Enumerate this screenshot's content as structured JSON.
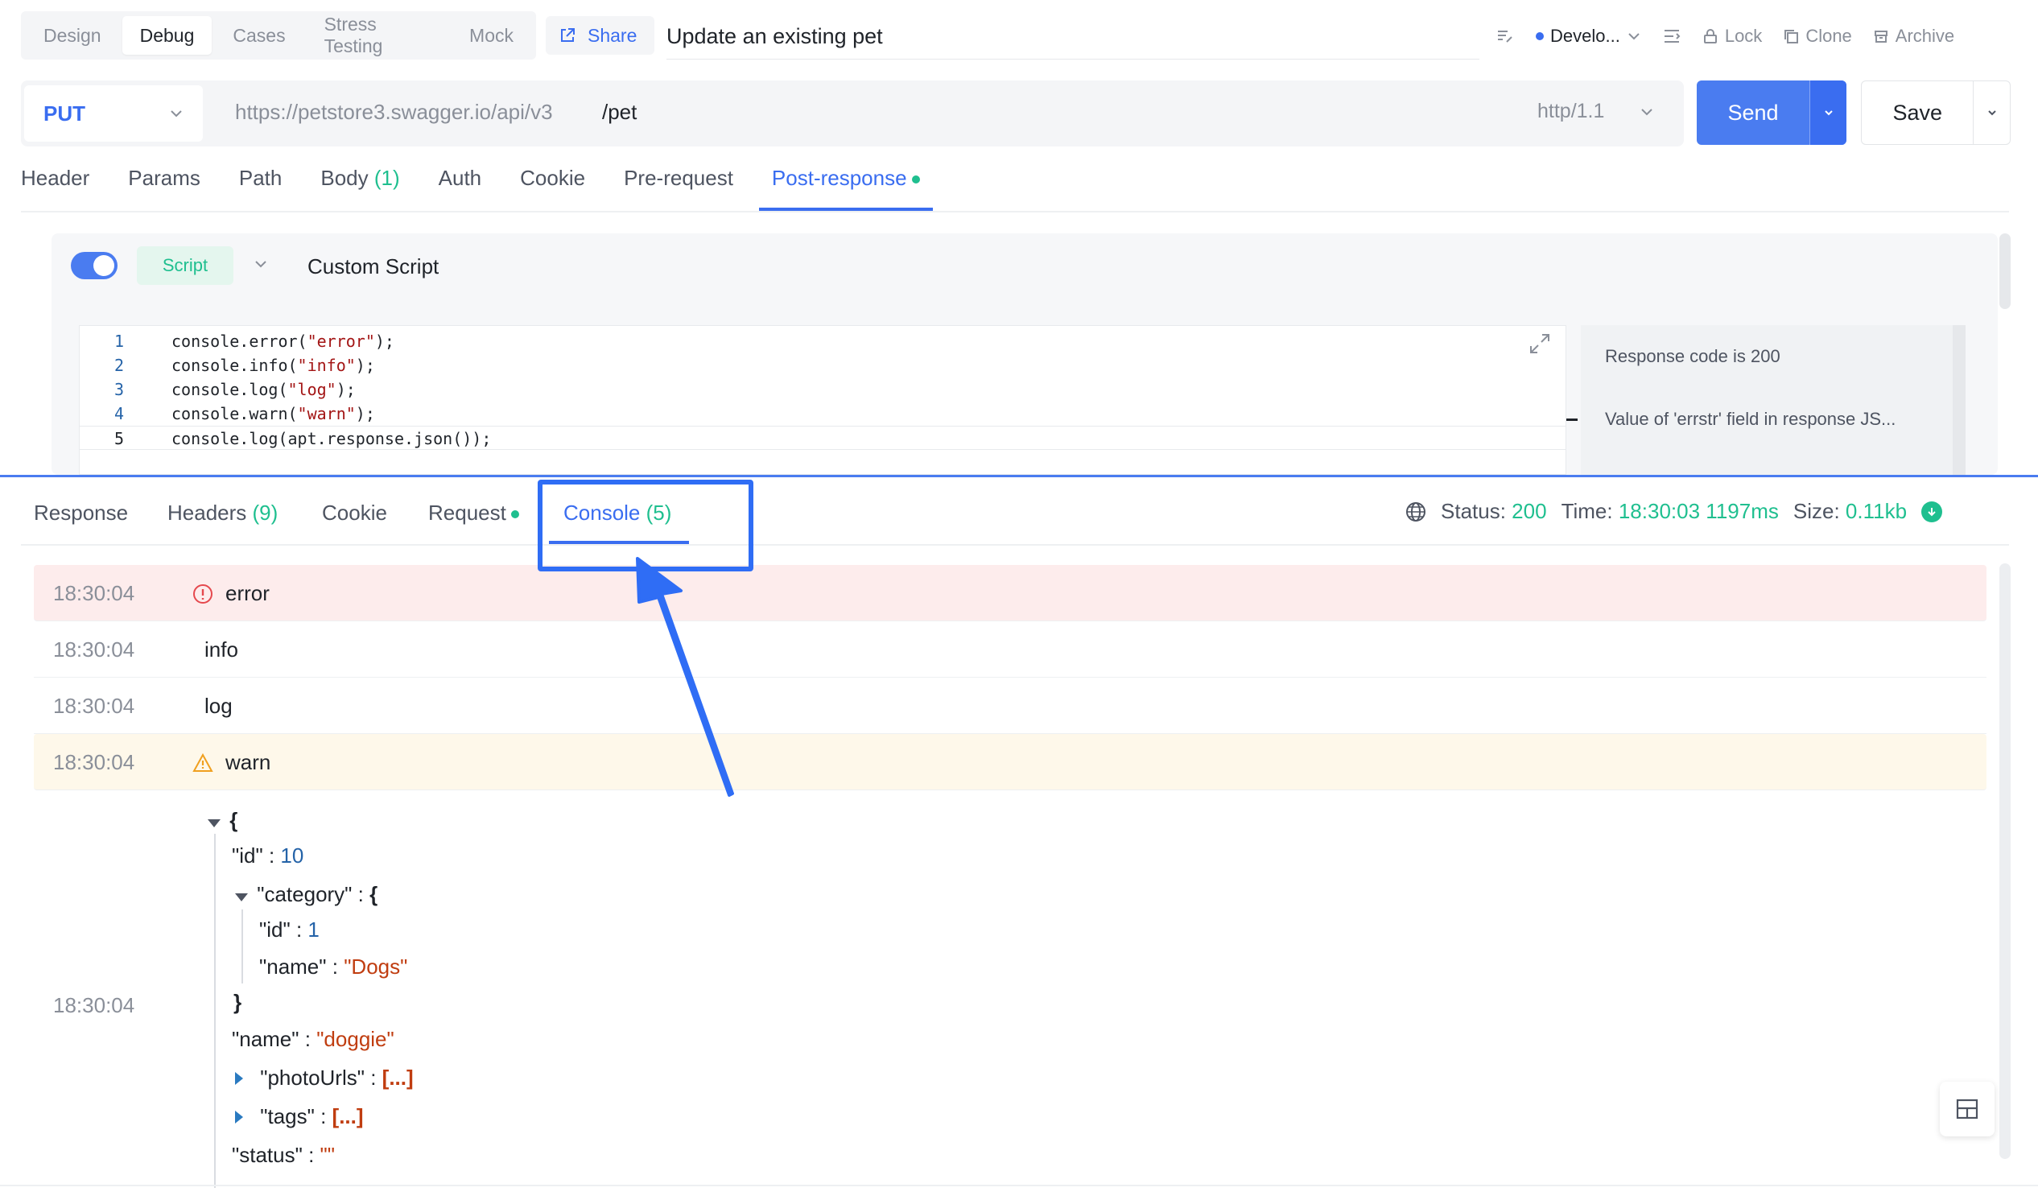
{
  "mode_tabs": [
    "Design",
    "Debug",
    "Cases",
    "Stress Testing",
    "Mock"
  ],
  "active_mode": "Debug",
  "share_label": "Share",
  "api_title": "Update an existing pet",
  "toolbar": {
    "environment": "Develo...",
    "lock": "Lock",
    "clone": "Clone",
    "archive": "Archive"
  },
  "request": {
    "method": "PUT",
    "base_url": "https://petstore3.swagger.io/api/v3",
    "path": "/pet",
    "protocol": "http/1.1",
    "send_label": "Send",
    "save_label": "Save"
  },
  "request_tabs": {
    "header": "Header",
    "params": "Params",
    "path": "Path",
    "body": "Body",
    "body_count": "(1)",
    "auth": "Auth",
    "cookie": "Cookie",
    "pre_request": "Pre-request",
    "post_response": "Post-response"
  },
  "script": {
    "enabled": true,
    "tag": "Script",
    "name": "Custom Script",
    "lines": [
      {
        "n": "1",
        "pre": "console.error(",
        "str": "\"error\"",
        "post": ");"
      },
      {
        "n": "2",
        "pre": "console.info(",
        "str": "\"info\"",
        "post": ");"
      },
      {
        "n": "3",
        "pre": "console.log(",
        "str": "\"log\"",
        "post": ");"
      },
      {
        "n": "4",
        "pre": "console.warn(",
        "str": "\"warn\"",
        "post": ");"
      },
      {
        "n": "5",
        "pre": "console.log(apt.response.json());",
        "str": "",
        "post": ""
      }
    ],
    "assertions": [
      "Response code is 200",
      "Value of 'errstr' field in response JS..."
    ]
  },
  "response_tabs": {
    "response": "Response",
    "headers": "Headers",
    "headers_count": "(9)",
    "cookie": "Cookie",
    "request": "Request",
    "console": "Console",
    "console_count": "(5)"
  },
  "status": {
    "status_label": "Status:",
    "status_value": "200",
    "time_label": "Time:",
    "time_value": "18:30:03",
    "duration": "1197ms",
    "size_label": "Size:",
    "size_value": "0.11kb"
  },
  "console_rows": [
    {
      "time": "18:30:04",
      "message": "error",
      "level": "error"
    },
    {
      "time": "18:30:04",
      "message": "info",
      "level": "info"
    },
    {
      "time": "18:30:04",
      "message": "log",
      "level": "log"
    },
    {
      "time": "18:30:04",
      "message": "warn",
      "level": "warn"
    }
  ],
  "json_log": {
    "time": "18:30:04",
    "open_brace": "{",
    "close_brace": "}",
    "id_key": "\"id\"",
    "id_value": "10",
    "category_key": "\"category\"",
    "category_id_key": "\"id\"",
    "category_id_value": "1",
    "category_name_key": "\"name\"",
    "category_name_value": "\"Dogs\"",
    "name_key": "\"name\"",
    "name_value": "\"doggie\"",
    "photo_key": "\"photoUrls\"",
    "tags_key": "\"tags\"",
    "status_key": "\"status\"",
    "status_value": "\"\"",
    "collapsed_array": "[...]",
    "separator": ":"
  },
  "colors": {
    "accent": "#3a6df0",
    "success": "#1fbf8f",
    "error_bg": "#fdecec",
    "warn_bg": "#fef8ea"
  }
}
